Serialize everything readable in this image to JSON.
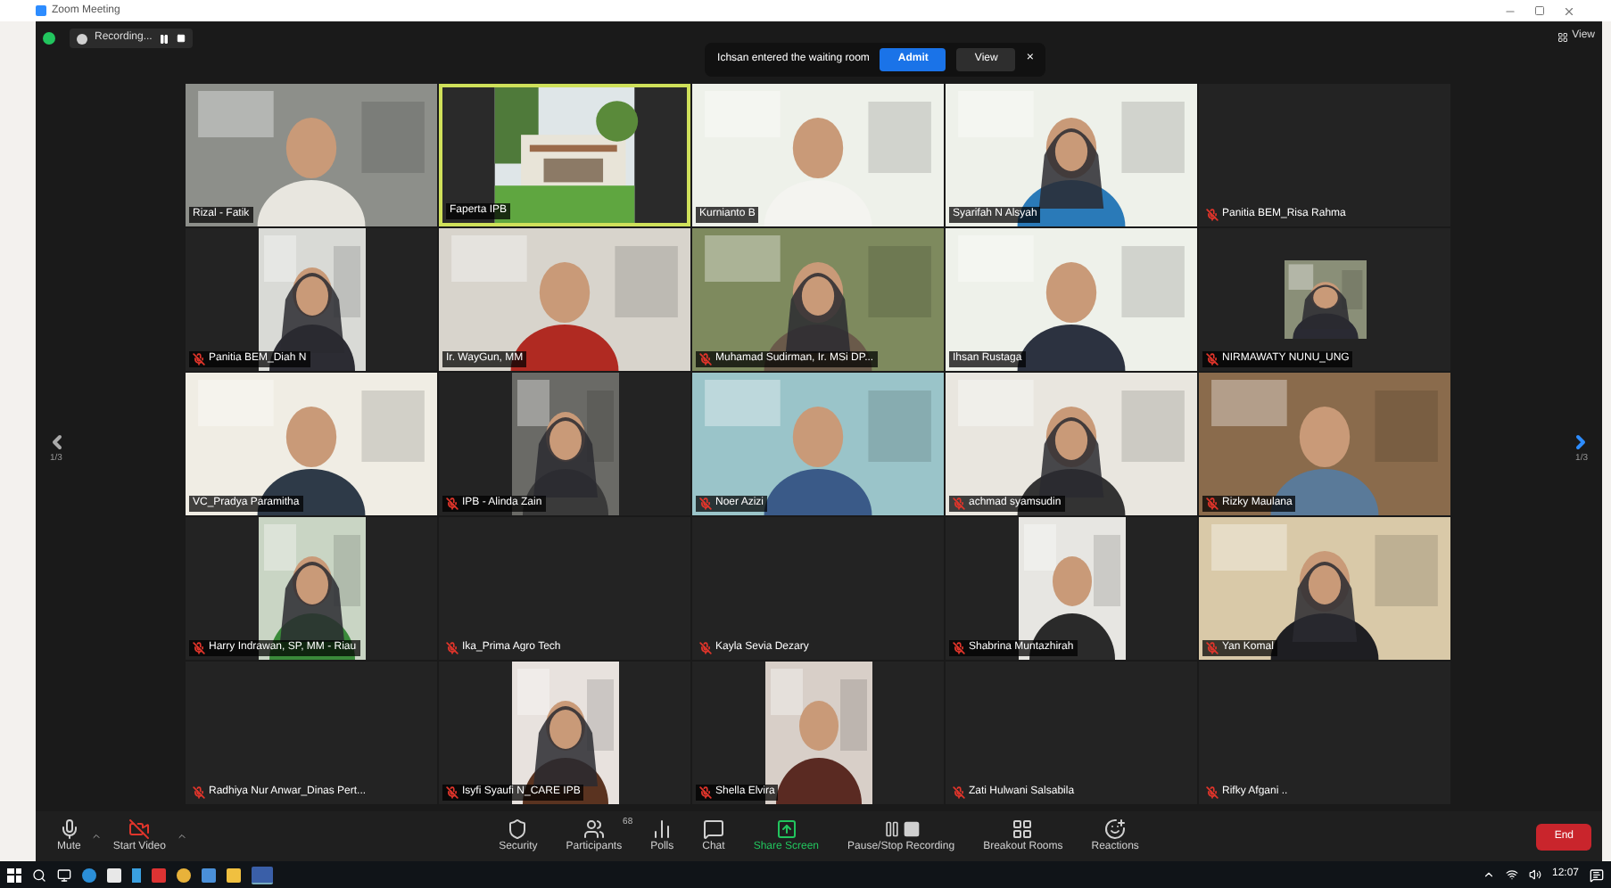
{
  "window": {
    "title": "Zoom Meeting"
  },
  "recording": {
    "label": "Recording..."
  },
  "notification": {
    "message": "Ichsan entered the waiting room",
    "admit": "Admit",
    "view": "View",
    "close": "×"
  },
  "view_button": "View",
  "pager": {
    "left": "1/3",
    "right": "1/3"
  },
  "tiles": [
    {
      "name": "Rizal - Fatik",
      "muted": false,
      "kind": "wide",
      "speaking": false
    },
    {
      "name": "Faperta IPB",
      "muted": false,
      "kind": "wide",
      "speaking": true
    },
    {
      "name": "Kurnianto B",
      "muted": false,
      "kind": "wide",
      "speaking": false
    },
    {
      "name": "Syarifah N Alsyah",
      "muted": false,
      "kind": "wide",
      "speaking": false
    },
    {
      "name": "Panitia BEM_Risa Rahma",
      "muted": true,
      "kind": "off",
      "speaking": false
    },
    {
      "name": "Panitia BEM_Diah N",
      "muted": true,
      "kind": "portrait",
      "speaking": false
    },
    {
      "name": "Ir. WayGun, MM",
      "muted": false,
      "kind": "wide",
      "speaking": false
    },
    {
      "name": "Muhamad Sudirman, Ir. MSi DP...",
      "muted": true,
      "kind": "wide",
      "speaking": false
    },
    {
      "name": "Ihsan Rustaga",
      "muted": false,
      "kind": "wide",
      "speaking": false
    },
    {
      "name": "NIRMAWATY NUNU_UNG",
      "muted": true,
      "kind": "small",
      "speaking": false
    },
    {
      "name": "VC_Pradya Paramitha",
      "muted": false,
      "kind": "wide",
      "speaking": false
    },
    {
      "name": "IPB - Alinda Zain",
      "muted": true,
      "kind": "portrait",
      "speaking": false
    },
    {
      "name": "Noer Azizi",
      "muted": true,
      "kind": "wide",
      "speaking": false
    },
    {
      "name": "achmad syamsudin",
      "muted": true,
      "kind": "wide",
      "speaking": false
    },
    {
      "name": "Rizky Maulana",
      "muted": true,
      "kind": "wide",
      "speaking": false
    },
    {
      "name": "Harry Indrawan, SP, MM - Riau",
      "muted": true,
      "kind": "portrait",
      "speaking": false
    },
    {
      "name": "Ika_Prima Agro Tech",
      "muted": true,
      "kind": "off",
      "speaking": false
    },
    {
      "name": "Kayla Sevia Dezary",
      "muted": true,
      "kind": "off",
      "speaking": false
    },
    {
      "name": "Shabrina Muntazhirah",
      "muted": true,
      "kind": "portrait",
      "speaking": false
    },
    {
      "name": "Yan Komal",
      "muted": true,
      "kind": "wide",
      "speaking": false
    },
    {
      "name": "Radhiya Nur Anwar_Dinas Pert...",
      "muted": true,
      "kind": "off",
      "speaking": false
    },
    {
      "name": "Isyfi Syaufi N_CARE IPB",
      "muted": true,
      "kind": "portrait",
      "speaking": false
    },
    {
      "name": "Shella Elvira",
      "muted": true,
      "kind": "portrait",
      "speaking": false
    },
    {
      "name": "Zati Hulwani Salsabila",
      "muted": true,
      "kind": "off",
      "speaking": false
    },
    {
      "name": "Rifky Afgani ..",
      "muted": true,
      "kind": "off",
      "speaking": false
    }
  ],
  "toolbar_left": [
    {
      "kind": "mic",
      "label": "Mute"
    },
    {
      "kind": "video-off",
      "label": "Start Video"
    }
  ],
  "toolbar_center": [
    {
      "kind": "security",
      "label": "Security"
    },
    {
      "kind": "participants",
      "label": "Participants",
      "count": "68"
    },
    {
      "kind": "polls",
      "label": "Polls"
    },
    {
      "kind": "chat",
      "label": "Chat"
    },
    {
      "kind": "share",
      "label": "Share Screen"
    },
    {
      "kind": "record",
      "label": "Pause/Stop Recording"
    },
    {
      "kind": "breakout",
      "label": "Breakout Rooms"
    },
    {
      "kind": "reactions",
      "label": "Reactions"
    }
  ],
  "end_button": "End",
  "taskbar": {
    "clock": "12:07"
  }
}
